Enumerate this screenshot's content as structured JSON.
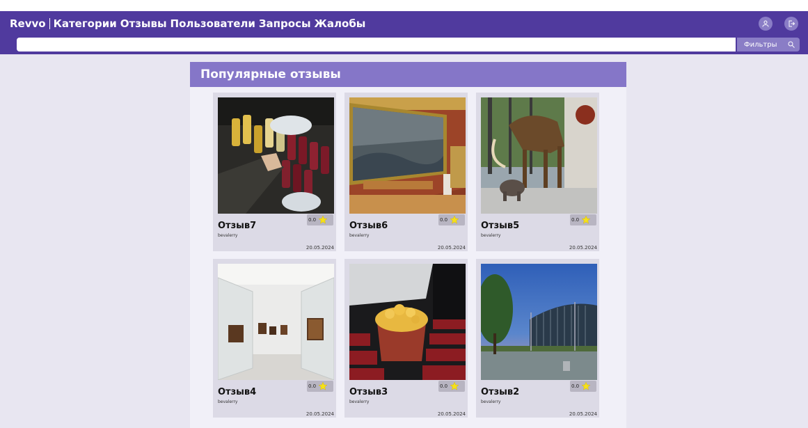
{
  "nav": {
    "brand": "Revvo",
    "links": [
      "Категории",
      "Отзывы",
      "Пользователи",
      "Запросы",
      "Жалобы"
    ],
    "search_placeholder": "",
    "filters_label": "Фильтры"
  },
  "panel": {
    "title": "Популярные отзывы"
  },
  "reviews": [
    {
      "title": "Отзыв7",
      "author": "bevalerry",
      "date": "20.05.2024",
      "rating": "0.0",
      "image": "bottles-photo"
    },
    {
      "title": "Отзыв6",
      "author": "bevalerry",
      "date": "20.05.2024",
      "rating": "0.0",
      "image": "painting-gallery-photo"
    },
    {
      "title": "Отзыв5",
      "author": "bevalerry",
      "date": "20.05.2024",
      "rating": "0.0",
      "image": "mammoth-skeleton-photo"
    },
    {
      "title": "Отзыв4",
      "author": "bevalerry",
      "date": "20.05.2024",
      "rating": "0.0",
      "image": "glass-gallery-photo"
    },
    {
      "title": "Отзыв3",
      "author": "bevalerry",
      "date": "20.05.2024",
      "rating": "0.0",
      "image": "popcorn-cinema-photo"
    },
    {
      "title": "Отзыв2",
      "author": "bevalerry",
      "date": "20.05.2024",
      "rating": "0.0",
      "image": "stadium-photo"
    }
  ],
  "colors": {
    "navbar": "#503a9e",
    "panel_header": "#8576c8",
    "star": "#f5e11a"
  }
}
